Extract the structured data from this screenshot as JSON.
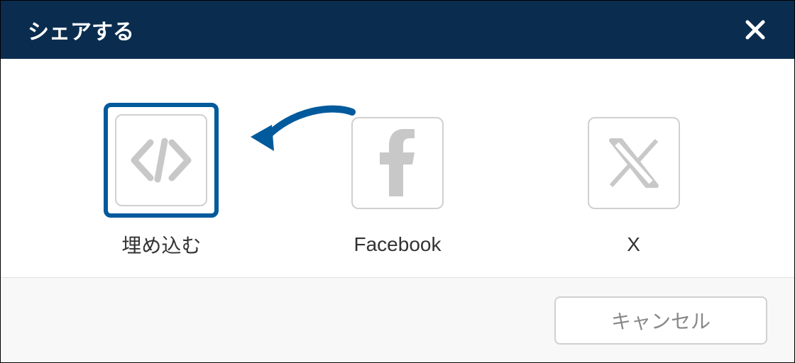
{
  "header": {
    "title": "シェアする"
  },
  "options": {
    "embed": {
      "label": "埋め込む"
    },
    "facebook": {
      "label": "Facebook"
    },
    "x": {
      "label": "X"
    }
  },
  "footer": {
    "cancel_label": "キャンセル"
  },
  "colors": {
    "header_bg": "#0a2d4f",
    "accent": "#005a9c",
    "border_gray": "#d0d0d0",
    "text_gray": "#888"
  }
}
